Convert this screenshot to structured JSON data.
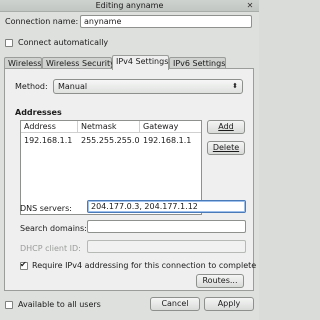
{
  "window": {
    "title": "Editing anyname",
    "close_glyph": "✕"
  },
  "connection": {
    "name_label": "Connection name:",
    "name_value": "anyname",
    "auto_connect_label": "Connect automatically",
    "auto_connect_checked": false
  },
  "tabs": [
    {
      "label": "Wireless",
      "active": false
    },
    {
      "label": "Wireless Security",
      "active": false
    },
    {
      "label": "IPv4 Settings",
      "active": true
    },
    {
      "label": "IPv6 Settings",
      "active": false
    }
  ],
  "ipv4": {
    "method_label": "Method:",
    "method_value": "Manual",
    "addresses_heading": "Addresses",
    "columns": [
      "Address",
      "Netmask",
      "Gateway"
    ],
    "rows": [
      [
        "192.168.1.1",
        "255.255.255.0",
        "192.168.1.1"
      ]
    ],
    "add_label": "Add",
    "delete_label": "Delete",
    "dns_label": "DNS servers:",
    "dns_value": "204.177.0.3, 204.177.1.12",
    "search_label": "Search domains:",
    "search_value": "",
    "dhcp_label": "DHCP client ID:",
    "dhcp_value": "",
    "require_label": "Require IPv4 addressing for this connection to complete",
    "require_checked": true,
    "routes_label": "Routes..."
  },
  "footer": {
    "all_users_label": "Available to all users",
    "all_users_checked": false,
    "cancel_label": "Cancel",
    "apply_label": "Apply"
  }
}
